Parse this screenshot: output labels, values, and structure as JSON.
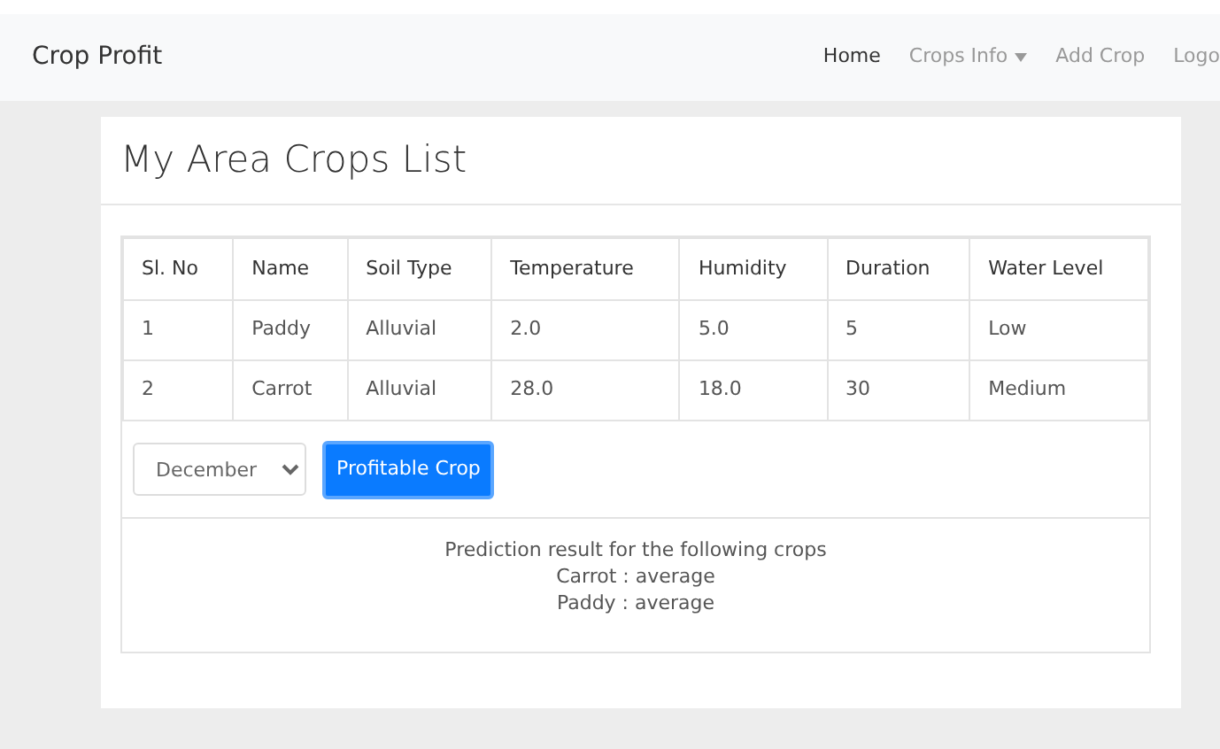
{
  "navbar": {
    "brand": "Crop Profit",
    "links": [
      {
        "label": "Home",
        "selected": true,
        "kind": "link"
      },
      {
        "label": "Crops Info",
        "selected": false,
        "kind": "dropdown"
      },
      {
        "label": "Add Crop",
        "selected": false,
        "kind": "link"
      },
      {
        "label": "Logo",
        "selected": false,
        "kind": "link"
      }
    ]
  },
  "card": {
    "title": "My Area Crops List"
  },
  "table": {
    "columns": [
      "Sl. No",
      "Name",
      "Soil Type",
      "Temperature",
      "Humidity",
      "Duration",
      "Water Level"
    ],
    "rows": [
      [
        "1",
        "Paddy",
        "Alluvial",
        "2.0",
        "5.0",
        "5",
        "Low"
      ],
      [
        "2",
        "Carrot",
        "Alluvial",
        "28.0",
        "18.0",
        "30",
        "Medium"
      ]
    ]
  },
  "month_select": {
    "value": "December"
  },
  "button": {
    "label": "Profitable Crop"
  },
  "result": {
    "lines": [
      "Prediction result for the following crops",
      "Carrot : average",
      "Paddy : average"
    ]
  }
}
